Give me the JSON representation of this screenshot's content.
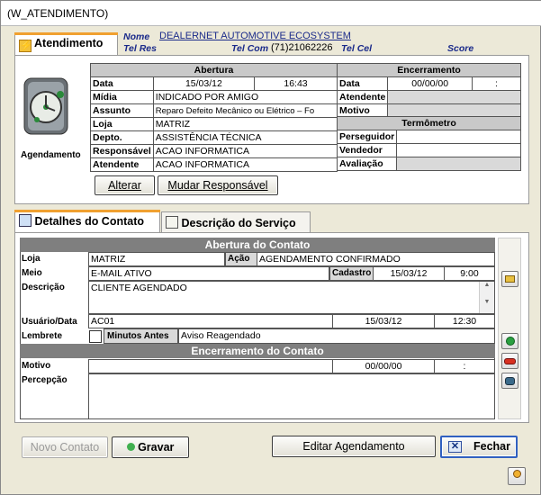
{
  "window": {
    "title": "(W_ATENDIMENTO)"
  },
  "header": {
    "nome_label": "Nome",
    "nome_value": "DEALERNET AUTOMOTIVE ECOSYSTEM",
    "telres_label": "Tel Res",
    "telcom_label": "Tel Com",
    "telcom_value": "(71)21062226",
    "telcel_label": "Tel Cel",
    "score_label": "Score"
  },
  "atendimento": {
    "tab_label": "Atendimento",
    "icon_caption": "Agendamento",
    "abertura_header": "Abertura",
    "encerramento_header": "Encerramento",
    "termometro_header": "Termômetro",
    "rows": {
      "data_label": "Data",
      "data_value": "15/03/12",
      "hora_value": "16:43",
      "midia_label": "Mídia",
      "midia_value": "INDICADO POR AMIGO",
      "assunto_label": "Assunto",
      "assunto_value": "Reparo Defeito Mecânico ou Elétrico – Fo",
      "loja_label": "Loja",
      "loja_value": "MATRIZ",
      "depto_label": "Depto.",
      "depto_value": "ASSISTÊNCIA TÉCNICA",
      "responsavel_label": "Responsável",
      "responsavel_value": "ACAO INFORMATICA",
      "atendente_label": "Atendente",
      "atendente_value": "ACAO INFORMATICA"
    },
    "enc": {
      "data_label": "Data",
      "data_value": "00/00/00",
      "hora_value": ":",
      "atendente_label": "Atendente",
      "motivo_label": "Motivo"
    },
    "termo": {
      "perseguidor_label": "Perseguidor",
      "vendedor_label": "Vendedor",
      "avaliacao_label": "Avaliação"
    },
    "buttons": {
      "alterar": "Alterar",
      "mudar_responsavel": "Mudar Responsável"
    }
  },
  "tabs2": {
    "detalhes": "Detalhes do Contato",
    "descricao": "Descrição do Serviço"
  },
  "contato": {
    "abertura_header": "Abertura do Contato",
    "loja_label": "Loja",
    "loja_value": "MATRIZ",
    "acao_label": "Ação",
    "acao_value": "AGENDAMENTO CONFIRMADO",
    "meio_label": "Meio",
    "meio_value": "E-MAIL ATIVO",
    "cadastro_label": "Cadastro",
    "cadastro_date": "15/03/12",
    "cadastro_time": "9:00",
    "descricao_label": "Descrição",
    "descricao_value": "CLIENTE AGENDADO",
    "usuario_label": "Usuário/Data",
    "usuario_value": "AC01",
    "usuario_date": "15/03/12",
    "usuario_time": "12:30",
    "lembrete_label": "Lembrete",
    "minutos_label": "Minutos Antes",
    "minutos_value": "Aviso Reagendado",
    "encerramento_header": "Encerramento do Contato",
    "motivo_label": "Motivo",
    "motivo_date": "00/00/00",
    "motivo_time": ":",
    "percepcao_label": "Percepção"
  },
  "footer": {
    "novo_contato": "Novo Contato",
    "gravar": "Gravar",
    "editar_agendamento": "Editar Agendamento",
    "fechar": "Fechar"
  }
}
